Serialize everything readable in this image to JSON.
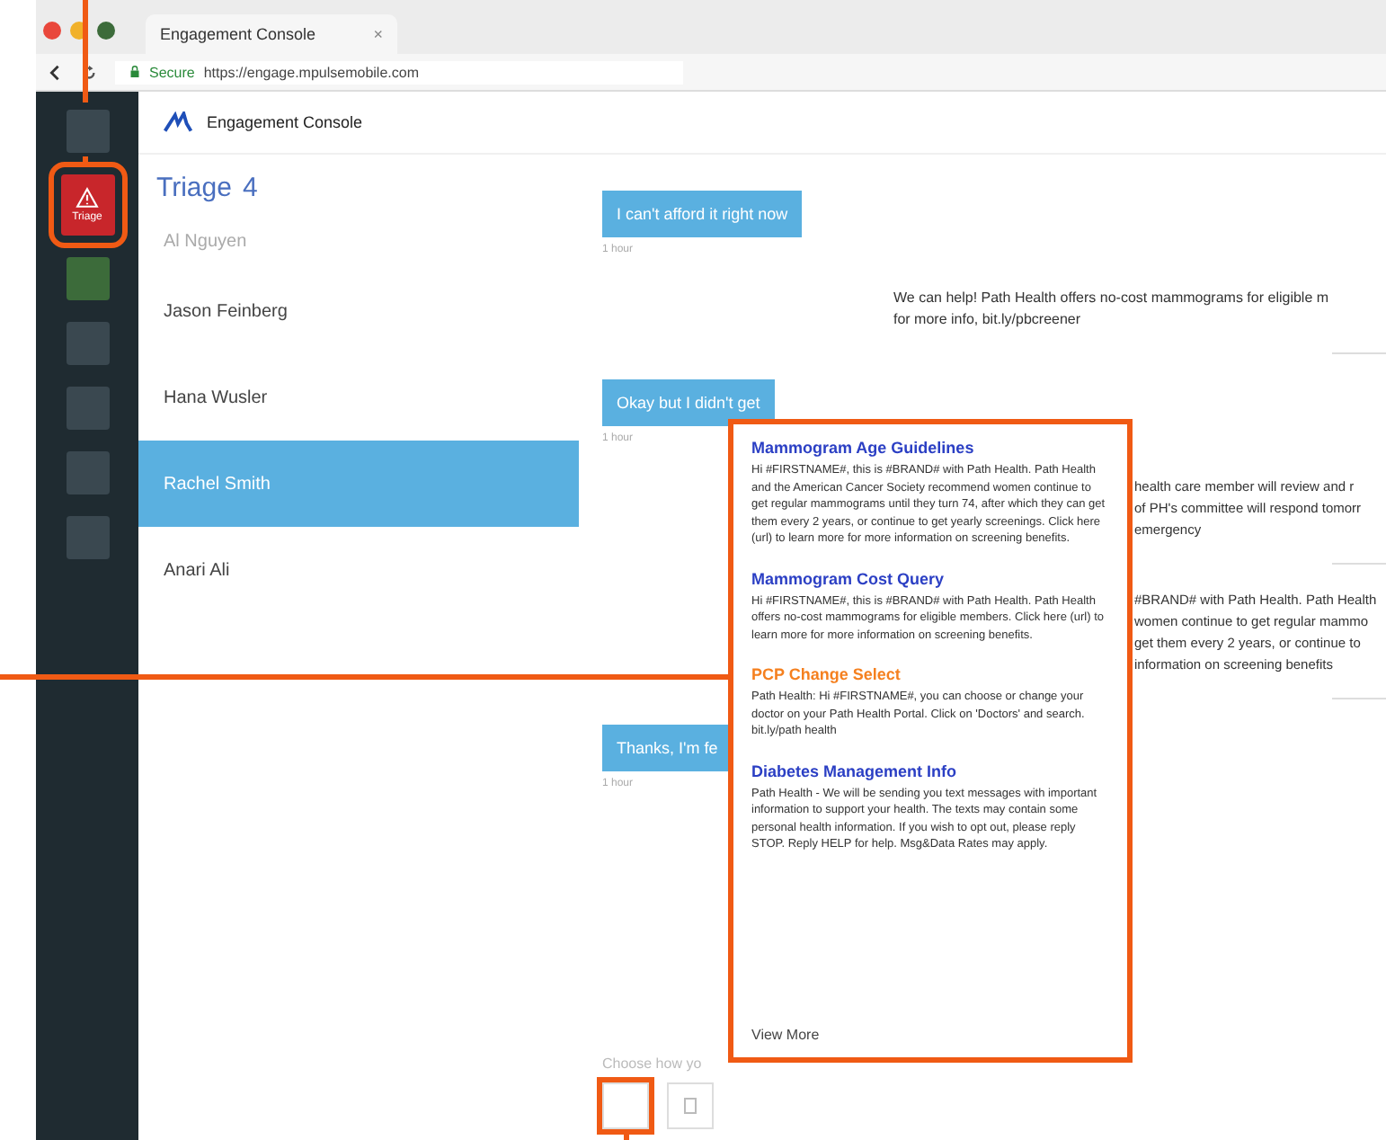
{
  "browser": {
    "tab_title": "Engagement Console",
    "tab_close": "×",
    "secure_label": "Secure",
    "url": "https://engage.mpulsemobile.com"
  },
  "sidebar": {
    "items": [
      {
        "kind": "plain",
        "selected": false
      },
      {
        "kind": "alert",
        "selected": true,
        "label": "Triage"
      },
      {
        "kind": "green",
        "selected": false
      },
      {
        "kind": "plain",
        "selected": false
      },
      {
        "kind": "plain",
        "selected": false
      },
      {
        "kind": "plain",
        "selected": false
      },
      {
        "kind": "plain",
        "selected": false
      }
    ]
  },
  "app": {
    "title": "Engagement Console"
  },
  "triage": {
    "title": "Triage",
    "count": "4"
  },
  "contacts": [
    {
      "name": "Al Nguyen",
      "selected": false,
      "muted": true
    },
    {
      "name": "Jason Feinberg",
      "selected": false,
      "muted": false
    },
    {
      "name": "Hana Wusler",
      "selected": false,
      "muted": false
    },
    {
      "name": "Rachel Smith",
      "selected": true,
      "muted": false
    },
    {
      "name": "Anari Ali",
      "selected": false,
      "muted": false
    }
  ],
  "messages": [
    {
      "kind": "sent",
      "text": "I can't afford it right now",
      "time": "1 hour"
    },
    {
      "kind": "received",
      "lines": [
        "We can help! Path Health offers no-cost mammograms for eligible m",
        "for more info, bit.ly/pbcreener"
      ]
    },
    {
      "kind": "sent",
      "text": "Okay but I didn't get",
      "time": "1 hour"
    },
    {
      "kind": "received_partial",
      "lines": [
        "health care member will review and r",
        "of PH's committee will respond tomorr",
        "emergency"
      ]
    },
    {
      "kind": "received_partial",
      "lines": [
        "#BRAND# with Path Health. Path Health",
        "women continue to get regular mammo",
        "get them every 2 years, or continue to",
        "information on screening benefits"
      ]
    },
    {
      "kind": "sent",
      "text": "Thanks, I'm fe",
      "time": "1 hour"
    }
  ],
  "composer": {
    "label": "Choose how yo"
  },
  "templates": [
    {
      "title": "Mammogram Age Guidelines",
      "highlighted": false,
      "body": "Hi #FIRSTNAME#, this is #BRAND# with Path Health. Path Health and the American Cancer Society recommend women continue to get regular mammograms until they turn 74, after which they can get them every 2 years, or continue to get yearly screenings. Click here (url) to learn more for more information on screening benefits."
    },
    {
      "title": "Mammogram Cost Query",
      "highlighted": false,
      "body": "Hi #FIRSTNAME#, this is #BRAND# with Path Health. Path Health offers no-cost mammograms for eligible members. Click here (url) to learn more for more information on screening benefits."
    },
    {
      "title": "PCP Change Select",
      "highlighted": true,
      "body": "Path Health: Hi #FIRSTNAME#, you can choose or change your doctor on your Path Health Portal. Click on 'Doctors' and search. bit.ly/path health"
    },
    {
      "title": "Diabetes Management Info",
      "highlighted": false,
      "body": "Path Health - We will be sending you text messages with important information to support your health. The texts may contain some personal health information. If you wish to opt out, please reply STOP. Reply HELP for help. Msg&Data Rates may apply."
    }
  ],
  "view_more": "View More"
}
